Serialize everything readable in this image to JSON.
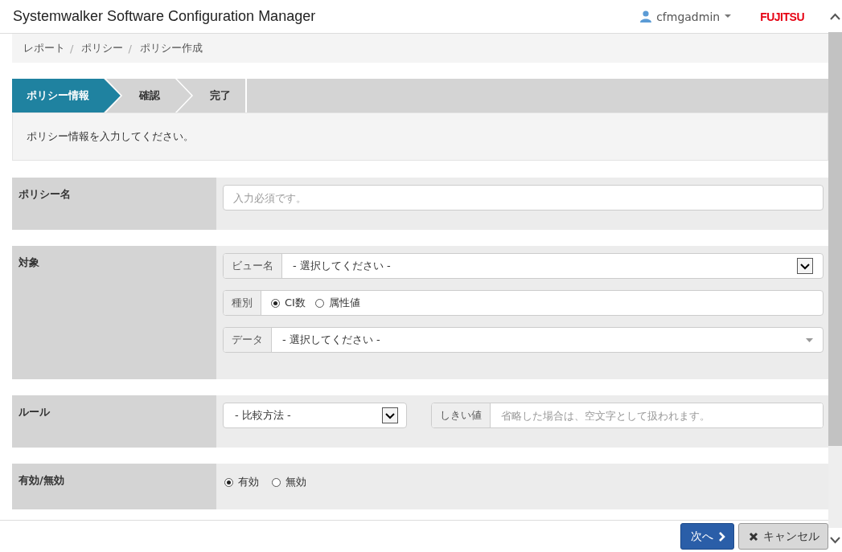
{
  "app_title": "Systemwalker Software Configuration Manager",
  "user": {
    "name": "cfmgadmin"
  },
  "logo": "FUJITSU",
  "breadcrumb": [
    {
      "label": "レポート",
      "separator": "/"
    },
    {
      "label": "ポリシー",
      "separator": "/"
    },
    {
      "label": "ポリシー作成"
    }
  ],
  "steps": [
    {
      "label": "ポリシー情報",
      "selected": true
    },
    {
      "label": "確認",
      "selected": false
    },
    {
      "label": "完了",
      "selected": false
    }
  ],
  "message": "ポリシー情報を入力してください。",
  "policy_name": {
    "label": "ポリシー名",
    "placeholder": "入力必須です。"
  },
  "target": {
    "label": "対象",
    "view": {
      "addon": "ビュー名",
      "value": "- 選択してください -"
    },
    "type": {
      "addon": "種別",
      "options": [
        {
          "label": "CI数",
          "selected": true
        },
        {
          "label": "属性値",
          "selected": false
        }
      ]
    },
    "data": {
      "addon": "データ",
      "value": "- 選択してください -"
    }
  },
  "rule": {
    "label": "ルール",
    "comparison": {
      "value": "- 比較方法 -"
    },
    "threshold": {
      "addon": "しきい値",
      "placeholder": "省略した場合は、空文字として扱われます。"
    }
  },
  "enabled": {
    "label": "有効/無効",
    "options": [
      {
        "label": "有効",
        "selected": true
      },
      {
        "label": "無効",
        "selected": false
      }
    ]
  },
  "buttons": [
    {
      "label": "次へ",
      "kind": "primary"
    },
    {
      "label": "キャンセル",
      "kind": "cancel"
    }
  ]
}
